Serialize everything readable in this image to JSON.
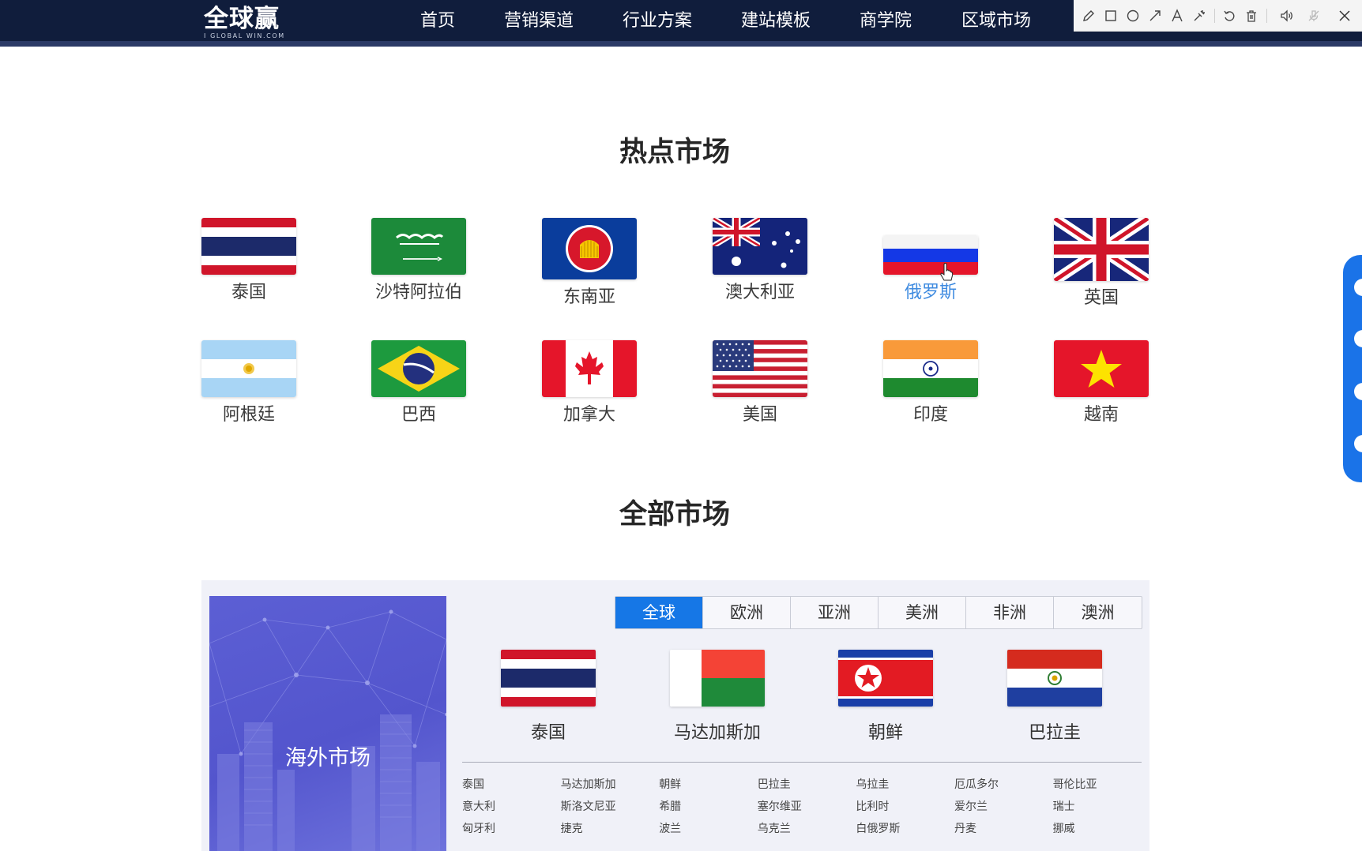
{
  "header": {
    "logo": {
      "main": "全球赢",
      "sub": "I GLOBAL WIN.COM"
    },
    "nav": [
      "首页",
      "营销渠道",
      "行业方案",
      "建站模板",
      "商学院",
      "区域市场"
    ]
  },
  "annotation_toolbar": {
    "tools": [
      "pencil-icon",
      "rectangle-icon",
      "circle-icon",
      "arrow-icon",
      "text-icon",
      "highlighter-icon",
      "undo-icon",
      "trash-icon",
      "speaker-icon",
      "microphone-muted-icon",
      "close-icon"
    ]
  },
  "hot_markets": {
    "title": "热点市场",
    "items": [
      {
        "name": "泰国",
        "flag": "thailand"
      },
      {
        "name": "沙特阿拉伯",
        "flag": "saudi-arabia"
      },
      {
        "name": "东南亚",
        "flag": "asean"
      },
      {
        "name": "澳大利亚",
        "flag": "australia"
      },
      {
        "name": "俄罗斯",
        "flag": "russia"
      },
      {
        "name": "英国",
        "flag": "united-kingdom"
      },
      {
        "name": "阿根廷",
        "flag": "argentina"
      },
      {
        "name": "巴西",
        "flag": "brazil"
      },
      {
        "name": "加拿大",
        "flag": "canada"
      },
      {
        "name": "美国",
        "flag": "united-states"
      },
      {
        "name": "印度",
        "flag": "india"
      },
      {
        "name": "越南",
        "flag": "vietnam"
      }
    ]
  },
  "all_markets": {
    "title": "全部市场",
    "promo_label": "海外市场",
    "tabs": [
      "全球",
      "欧洲",
      "亚洲",
      "美洲",
      "非洲",
      "澳洲"
    ],
    "active_tab": "全球",
    "featured": [
      {
        "name": "泰国",
        "flag": "thailand"
      },
      {
        "name": "马达加斯加",
        "flag": "madagascar"
      },
      {
        "name": "朝鲜",
        "flag": "north-korea"
      },
      {
        "name": "巴拉圭",
        "flag": "paraguay"
      }
    ],
    "countries": [
      "泰国",
      "马达加斯加",
      "朝鲜",
      "巴拉圭",
      "乌拉圭",
      "厄瓜多尔",
      "哥伦比亚",
      "意大利",
      "斯洛文尼亚",
      "希腊",
      "塞尔维亚",
      "比利时",
      "爱尔兰",
      "瑞士",
      "匈牙利",
      "捷克",
      "波兰",
      "乌克兰",
      "白俄罗斯",
      "丹麦",
      "挪威"
    ]
  },
  "colors": {
    "nav_background": "#101d3c",
    "active_tab": "#1677e6",
    "hover_label": "#3f8be0",
    "side_widget": "#1a73e8",
    "promo_background": "#5355cd"
  }
}
